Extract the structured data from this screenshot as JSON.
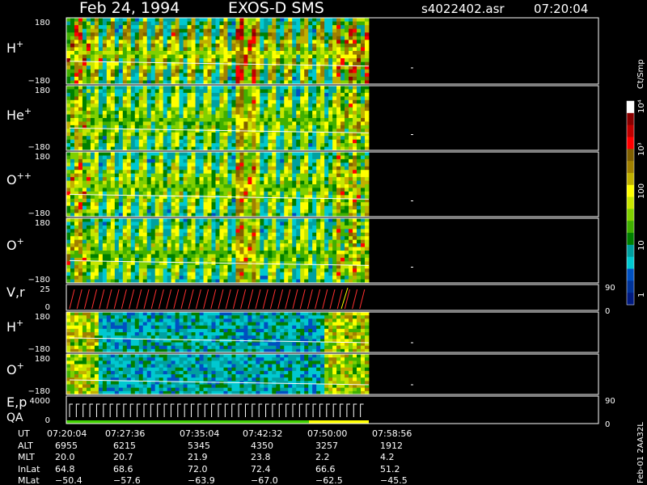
{
  "header": {
    "date": "Feb 24, 1994",
    "instrument": "EXOS-D SMS",
    "filename": "s4022402.asr",
    "time": "07:20:04"
  },
  "colorbar": {
    "unit": "Ct/Smp",
    "scale": "log",
    "tick_labels": [
      "10⁴",
      "10³",
      "100",
      "10",
      "1"
    ],
    "colors": [
      "#ffffff",
      "#8b0000",
      "#c00000",
      "#ff0000",
      "#806000",
      "#a08000",
      "#c0b000",
      "#ffff00",
      "#c8e600",
      "#80d000",
      "#40b000",
      "#008000",
      "#00a0a0",
      "#00c8d0",
      "#0050c0",
      "#003399",
      "#001a80"
    ]
  },
  "footer": {
    "row_labels": [
      "UT",
      "ALT",
      "MLT",
      "InLat",
      "MLat"
    ],
    "columns": [
      [
        "07:20:04",
        "6955",
        "20.0",
        "64.8",
        "−50.4"
      ],
      [
        "07:27:36",
        "6215",
        "20.7",
        "68.6",
        "−57.6"
      ],
      [
        "07:35:04",
        "5345",
        "21.9",
        "72.0",
        "−63.9"
      ],
      [
        "07:42:32",
        "4350",
        "23.8",
        "72.4",
        "−67.0"
      ],
      [
        "07:50:00",
        "3257",
        "2.2",
        "66.6",
        "−62.5"
      ],
      [
        "07:58:56",
        "1912",
        "4.2",
        "51.2",
        "−45.5"
      ]
    ],
    "version_label": "Feb-01 2AA32L"
  },
  "chart_data": {
    "type": "heatmap",
    "time_range": [
      "07:20:04",
      "07:58:56"
    ],
    "colorbar_unit": "Ct/Smp",
    "panels": [
      {
        "label": "H",
        "superscript": "+",
        "ytick_top": "180",
        "ytick_bottom": "−180",
        "ylim": [
          -180,
          180
        ],
        "kind": "pitch_spectrogram",
        "intensity": 1.0
      },
      {
        "label": "He",
        "superscript": "+",
        "ytick_top": "180",
        "ytick_bottom": "−180",
        "ylim": [
          -180,
          180
        ],
        "kind": "pitch_spectrogram",
        "intensity": 0.7
      },
      {
        "label": "O",
        "superscript": "++",
        "ytick_top": "180",
        "ytick_bottom": "−180",
        "ylim": [
          -180,
          180
        ],
        "kind": "pitch_spectrogram",
        "intensity": 0.75
      },
      {
        "label": "O",
        "superscript": "+",
        "ytick_top": "180",
        "ytick_bottom": "−180",
        "ylim": [
          -180,
          180
        ],
        "kind": "pitch_spectrogram",
        "intensity": 0.7
      },
      {
        "label": "V,r",
        "superscript": "",
        "ytick_top": "25",
        "ytick_bottom": "0",
        "right_top": "90",
        "right_bottom": "0",
        "ylim": [
          0,
          25
        ],
        "kind": "line"
      },
      {
        "label": "H",
        "superscript": "+",
        "ytick_top": "180",
        "ytick_bottom": "−180",
        "ylim": [
          -180,
          180
        ],
        "kind": "low_energy",
        "intensity": 0.5
      },
      {
        "label": "O",
        "superscript": "+",
        "ytick_top": "180",
        "ytick_bottom": "−180",
        "ylim": [
          -180,
          180
        ],
        "kind": "low_energy",
        "intensity": 0.45
      },
      {
        "label": "E,p",
        "label2": "QA",
        "superscript": "",
        "ytick_top": "4000",
        "ytick_bottom": "0",
        "right_top": "90",
        "right_bottom": "0",
        "ylim": [
          0,
          4000
        ],
        "kind": "sweep"
      }
    ]
  }
}
